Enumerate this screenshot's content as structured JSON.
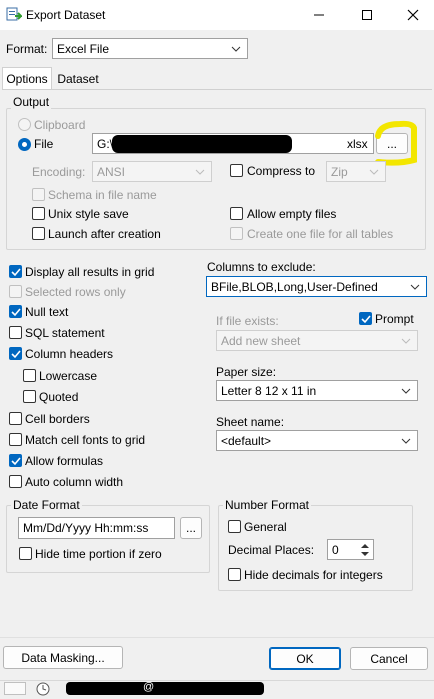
{
  "window": {
    "title": "Export Dataset"
  },
  "format": {
    "label": "Format:",
    "value": "Excel File"
  },
  "tabs": [
    {
      "label": "Options"
    },
    {
      "label": "Dataset"
    }
  ],
  "output": {
    "group_label": "Output",
    "clipboard_label": "Clipboard",
    "file_label": "File",
    "file_path_start": "G:\\",
    "file_path_end": "xlsx",
    "browse_label": "...",
    "encoding_label": "Encoding:",
    "encoding_value": "ANSI",
    "compress_label": "Compress to",
    "compress_value": "Zip",
    "schema_label": "Schema in file name",
    "unix_style_label": "Unix style save",
    "allow_empty_label": "Allow empty files",
    "launch_label": "Launch after creation",
    "one_file_label": "Create one file for all tables"
  },
  "options": {
    "display_all_label": "Display all results in grid",
    "selected_rows_label": "Selected rows only",
    "null_text_label": "Null text",
    "sql_statement_label": "SQL statement",
    "column_headers_label": "Column headers",
    "lowercase_label": "Lowercase",
    "quoted_label": "Quoted",
    "cell_borders_label": "Cell borders",
    "match_fonts_label": "Match cell fonts to grid",
    "allow_formulas_label": "Allow formulas",
    "auto_column_label": "Auto column width"
  },
  "columns_exclude": {
    "label": "Columns to exclude:",
    "value": "BFile,BLOB,Long,User-Defined"
  },
  "file_exists": {
    "label": "If file exists:",
    "prompt_label": "Prompt",
    "value": "Add new sheet"
  },
  "paper": {
    "label": "Paper size:",
    "value": "Letter 8 12 x 11 in"
  },
  "sheet": {
    "label": "Sheet name:",
    "value": "<default>"
  },
  "date_format": {
    "group_label": "Date Format",
    "value": "Mm/Dd/Yyyy Hh:mm:ss",
    "browse_label": "...",
    "hide_time_label": "Hide time portion if zero"
  },
  "number_format": {
    "group_label": "Number Format",
    "general_label": "General",
    "decimal_label": "Decimal Places:",
    "decimal_value": "0",
    "hide_decimals_label": "Hide decimals for integers"
  },
  "buttons": {
    "data_masking": "Data Masking...",
    "ok": "OK",
    "cancel": "Cancel"
  },
  "statusbar": {
    "at_sign": "@"
  },
  "colors": {
    "accent": "#0067c0",
    "highlight": "#f3e600",
    "redaction": "#000000"
  }
}
